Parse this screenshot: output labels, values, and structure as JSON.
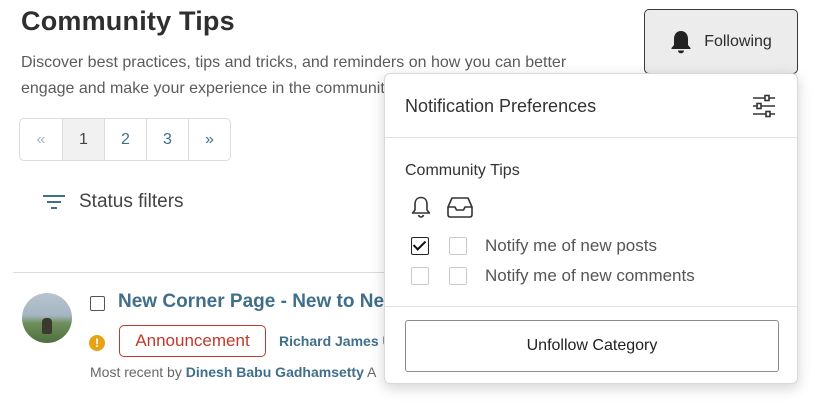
{
  "page": {
    "title": "Community Tips",
    "description": "Discover best practices, tips and tricks, and reminders on how you can better\nengage and make your experience in the community"
  },
  "pagination": {
    "prev": "«",
    "pages": [
      "1",
      "2",
      "3"
    ],
    "next": "»",
    "active_page": "1"
  },
  "filters": {
    "status_label": "Status filters"
  },
  "post": {
    "title": "New Corner Page - New to Net",
    "badge": "Announcement",
    "author": "Richard James U",
    "recent_prefix": "Most recent by",
    "recent_author": "Dinesh Babu Gadhamsetty",
    "recent_suffix": "A"
  },
  "follow_button": {
    "label": "Following",
    "icon": "bell-filled-icon"
  },
  "notification_popover": {
    "title": "Notification Preferences",
    "category": "Community Tips",
    "channel_icons": [
      "bell-icon",
      "inbox-icon"
    ],
    "options": [
      {
        "label": "Notify me of new posts",
        "bell_checked": true,
        "inbox_checked": false
      },
      {
        "label": "Notify me of new comments",
        "bell_checked": false,
        "inbox_checked": false
      }
    ],
    "unfollow_label": "Unfollow Category"
  },
  "colors": {
    "link": "#3f6f8a",
    "badge_red": "#c0392b",
    "warning": "#e8a215"
  }
}
